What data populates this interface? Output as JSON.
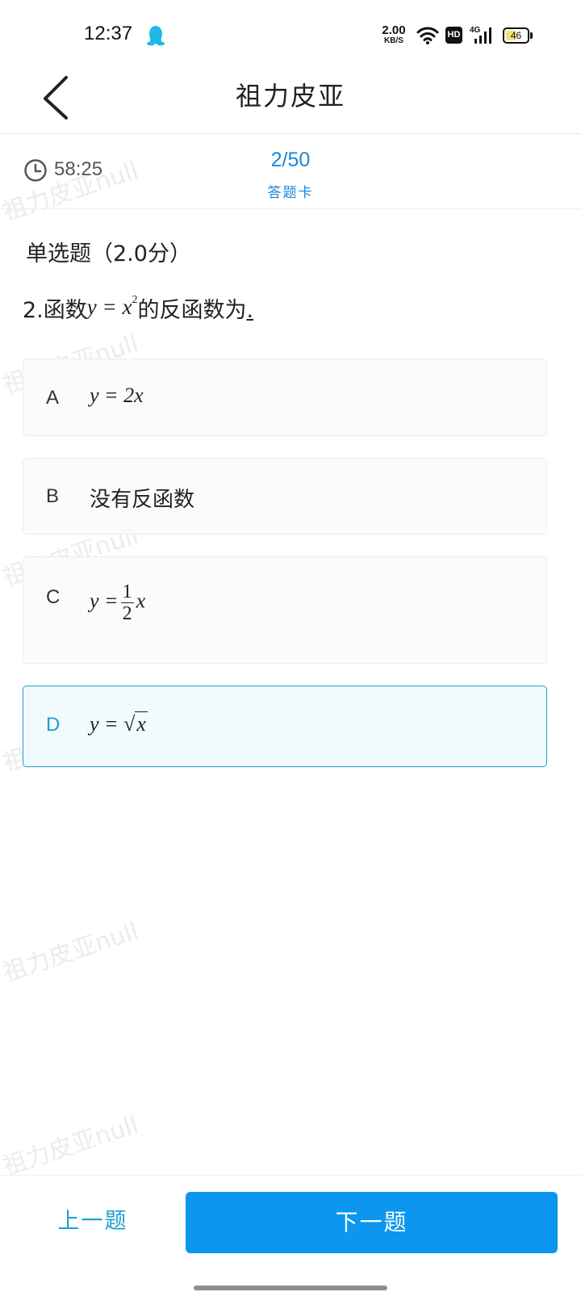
{
  "status_bar": {
    "time": "12:37",
    "network_speed_value": "2.00",
    "network_speed_unit": "KB/S",
    "hd_label": "HD",
    "signal_label": "4G",
    "battery_level": "46",
    "icons": [
      "qq-penguin-icon",
      "wifi-icon",
      "hd-icon",
      "signal-icon",
      "battery-icon"
    ]
  },
  "header": {
    "title": "祖力皮亚",
    "back_icon": "chevron-left-icon"
  },
  "exam_bar": {
    "timer": "58:25",
    "progress": "2/50",
    "answer_card_label": "答题卡"
  },
  "question": {
    "type_label": "单选题（2.0分）",
    "number_prefix": "2.函数",
    "formula_base": "y = x",
    "formula_exponent": "2",
    "suffix": "的反函数为",
    "end_mark": "."
  },
  "options": [
    {
      "letter": "A",
      "content": "y = 2x",
      "selected": false
    },
    {
      "letter": "B",
      "content": "没有反函数",
      "selected": false
    },
    {
      "letter": "C",
      "prefix": "y =",
      "numerator": "1",
      "denominator": "2",
      "suffix": "x",
      "selected": false
    },
    {
      "letter": "D",
      "prefix": "y =",
      "radicand": "x",
      "selected": true
    }
  ],
  "watermarks": [
    "祖力皮亚null",
    "祖力皮亚null",
    "祖力皮亚null",
    "祖力皮亚null",
    "祖力皮亚null",
    "祖力皮亚null"
  ],
  "footer": {
    "prev_label": "上一题",
    "next_label": "下一题"
  },
  "colors": {
    "accent": "#1d9fd2",
    "primary_button": "#0c96f0",
    "selected_background": "#f1fafd"
  }
}
